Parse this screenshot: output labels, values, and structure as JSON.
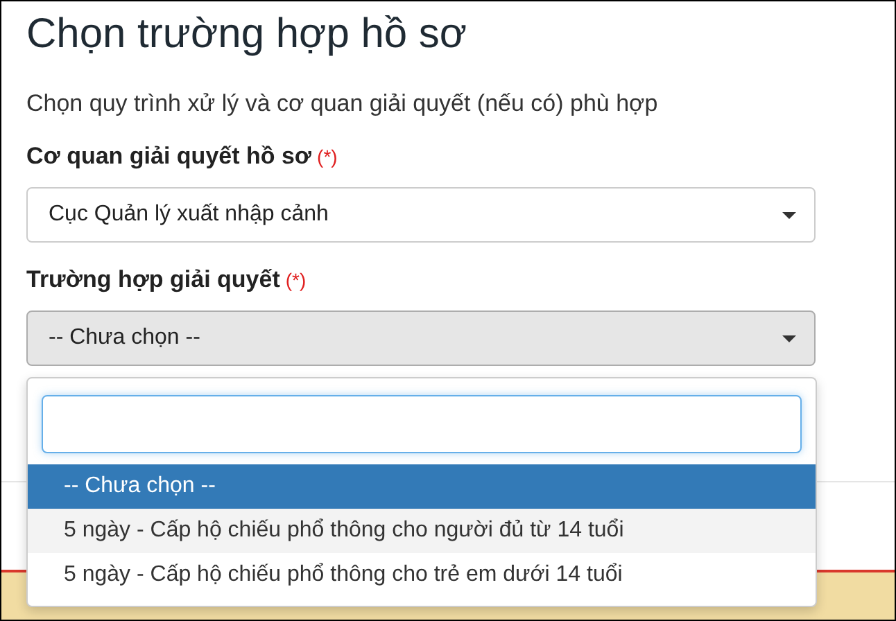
{
  "dialog": {
    "title": "Chọn trường hợp hồ sơ",
    "subtitle": "Chọn quy trình xử lý và cơ quan giải quyết (nếu có) phù hợp",
    "fields": [
      {
        "label": "Cơ quan giải quyết hồ sơ",
        "required_mark": "(*)",
        "value": "Cục Quản lý xuất nhập cảnh",
        "open": false
      },
      {
        "label": "Trường hợp giải quyết",
        "required_mark": "(*)",
        "value": "-- Chưa chọn --",
        "open": true
      }
    ]
  },
  "dropdown": {
    "options": [
      {
        "label": "-- Chưa chọn --",
        "selected": true,
        "highlighted": false
      },
      {
        "label": "5 ngày - Cấp hộ chiếu phổ thông cho người đủ từ 14 tuổi",
        "selected": false,
        "highlighted": true
      },
      {
        "label": "5 ngày - Cấp hộ chiếu phổ thông cho trẻ em dưới 14 tuổi",
        "selected": false,
        "highlighted": false
      }
    ]
  }
}
